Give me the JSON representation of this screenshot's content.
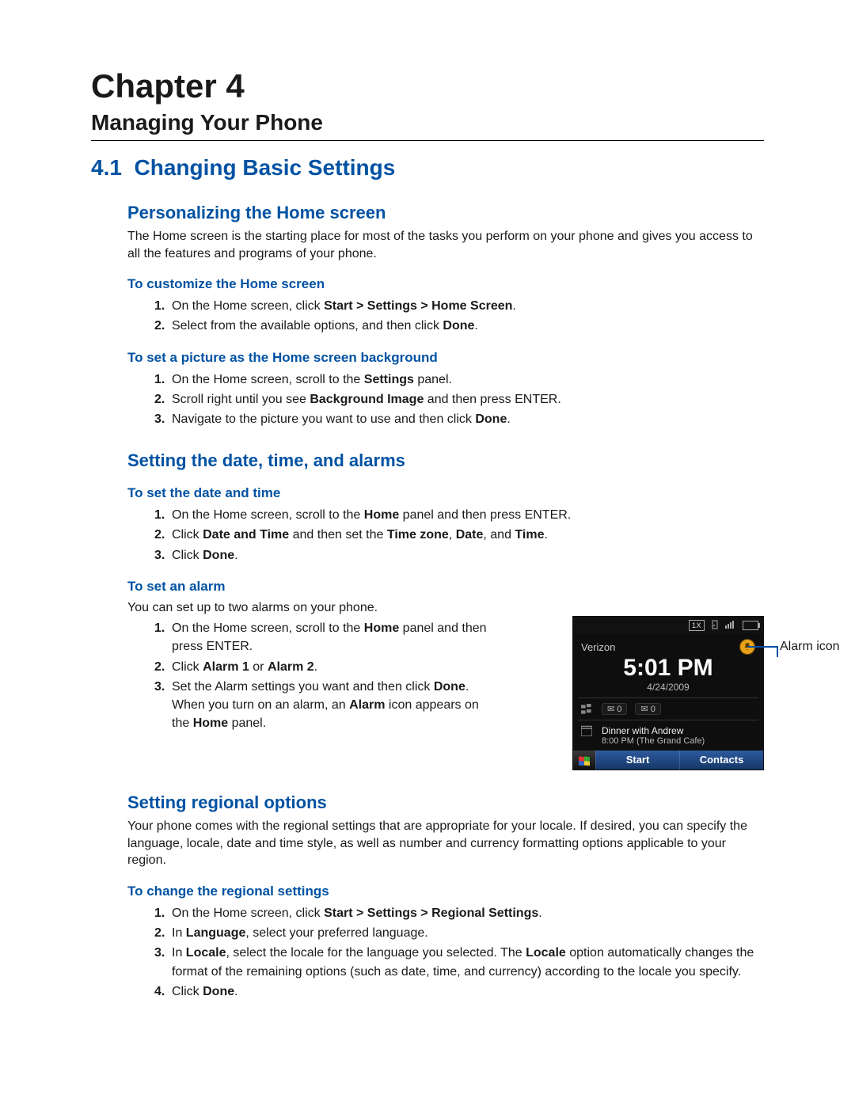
{
  "chapter_label": "Chapter 4",
  "chapter_title": "Managing Your Phone",
  "section": {
    "number": "4.1",
    "title": "Changing Basic Settings"
  },
  "personalizing": {
    "heading": "Personalizing the Home screen",
    "intro": "The Home screen is the starting place for most of the tasks you perform on your phone and gives you access to all the features and programs of your phone.",
    "customize": {
      "heading": "To customize the Home screen",
      "s1_a": "On the Home screen, click ",
      "s1_b": "Start > Settings > Home Screen",
      "s1_c": ".",
      "s2_a": "Select from the available options, and then click ",
      "s2_b": "Done",
      "s2_c": "."
    },
    "background": {
      "heading": "To set a picture as the Home screen background",
      "s1_a": "On the Home screen, scroll to the ",
      "s1_b": "Settings",
      "s1_c": " panel.",
      "s2_a": "Scroll right until you see ",
      "s2_b": "Background Image",
      "s2_c": " and then press ENTER.",
      "s3_a": "Navigate to the picture you want to use and then click ",
      "s3_b": "Done",
      "s3_c": "."
    }
  },
  "datetime": {
    "heading": "Setting the date, time, and alarms",
    "setdt": {
      "heading": "To set the date and time",
      "s1_a": "On the Home screen, scroll to the ",
      "s1_b": "Home",
      "s1_c": " panel and then press ENTER.",
      "s2_a": "Click ",
      "s2_b": "Date and Time",
      "s2_c": " and then set the ",
      "s2_d": "Time zone",
      "s2_e": ", ",
      "s2_f": "Date",
      "s2_g": ", and ",
      "s2_h": "Time",
      "s2_i": ".",
      "s3_a": "Click ",
      "s3_b": "Done",
      "s3_c": "."
    },
    "alarm": {
      "heading": "To set an alarm",
      "intro": "You can set up to two alarms on your phone.",
      "s1_a": "On the Home screen, scroll to the ",
      "s1_b": "Home",
      "s1_c": " panel and then press ENTER.",
      "s2_a": "Click ",
      "s2_b": "Alarm 1",
      "s2_c": " or ",
      "s2_d": "Alarm 2",
      "s2_e": ".",
      "s3_a": "Set the Alarm settings you want and then click ",
      "s3_b": "Done",
      "s3_c": ". When you turn on an alarm, an ",
      "s3_d": "Alarm",
      "s3_e": " icon appears on the ",
      "s3_f": "Home",
      "s3_g": " panel.",
      "callout": "Alarm icon"
    }
  },
  "regional": {
    "heading": "Setting regional options",
    "intro": "Your phone comes with the regional settings that are appropriate for your locale. If desired, you can specify the language, locale, date and time style, as well as number and currency formatting options applicable to your region.",
    "change": {
      "heading": "To change the regional settings",
      "s1_a": "On the Home screen, click ",
      "s1_b": "Start > Settings > Regional Settings",
      "s1_c": ".",
      "s2_a": "In ",
      "s2_b": "Language",
      "s2_c": ", select your preferred language.",
      "s3_a": "In ",
      "s3_b": "Locale",
      "s3_c": ", select the locale for the language you selected. The ",
      "s3_d": "Locale",
      "s3_e": " option automatically changes the format of the remaining options (such as date, time, and currency) according to the locale you specify.",
      "s4_a": "Click ",
      "s4_b": "Done",
      "s4_c": "."
    }
  },
  "phone": {
    "sig_label": "1X",
    "carrier": "Verizon",
    "time": "5:01 PM",
    "date": "4/24/2009",
    "count_msg": "0",
    "count_mail": "0",
    "event_title": "Dinner with Andrew",
    "event_sub": "8:00 PM (The Grand Cafe)",
    "soft_left": "Start",
    "soft_right": "Contacts"
  }
}
